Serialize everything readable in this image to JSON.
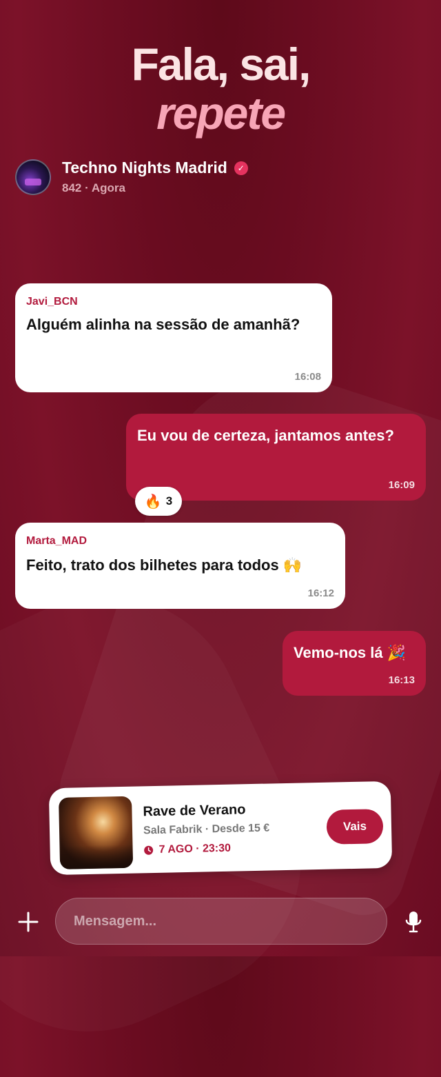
{
  "hero": {
    "line1": "Fala, sai,",
    "line2": "repete"
  },
  "chat": {
    "name": "Techno Nights Madrid",
    "verified_icon": "verified-badge-icon",
    "meta": "842 · Agora"
  },
  "messages": [
    {
      "direction": "incoming",
      "sender": "Javi_BCN",
      "text": "Alguém alinha na sessão de amanhã?",
      "time": "16:08"
    },
    {
      "direction": "outgoing",
      "text": "Eu vou de certeza, jantamos antes?",
      "time": "16:09",
      "reaction": {
        "emoji": "🔥",
        "count": "3"
      }
    },
    {
      "direction": "incoming",
      "sender": "Marta_MAD",
      "text": "Feito, trato dos bilhetes para todos 🙌",
      "time": "16:12"
    },
    {
      "direction": "outgoing",
      "text": "Vemo-nos lá 🎉",
      "time": "16:13"
    }
  ],
  "event": {
    "title": "Rave de Verano",
    "venue": "Sala Fabrik · Desde 15 €",
    "date": "7 AGO · 23:30",
    "button": "Vais"
  },
  "composer": {
    "placeholder": "Mensagem..."
  },
  "colors": {
    "accent": "#b21a3d",
    "background": "#6d0d22",
    "hero_accent": "#f7a5b6"
  }
}
